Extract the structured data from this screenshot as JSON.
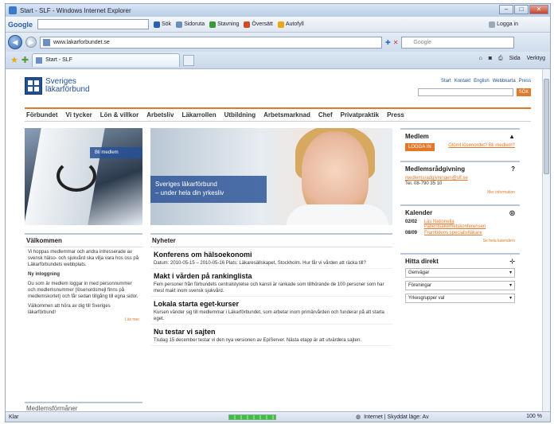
{
  "window": {
    "title": "Start - SLF - Windows Internet Explorer",
    "minimize": "–",
    "maximize": "□",
    "close": "✕"
  },
  "google_toolbar": {
    "logo": "Google",
    "items": [
      "Sök",
      "Sidoruta",
      "Stavning",
      "Översätt",
      "Autofyll"
    ],
    "signin": "Logga in"
  },
  "address": {
    "url": "www.lakarforbundet.se",
    "search_placeholder": "Google"
  },
  "tabs": {
    "active_label": "Start - SLF"
  },
  "command_bar": [
    "Sida",
    "Verktyg"
  ],
  "site": {
    "logo_line1": "Sveriges",
    "logo_line2": "läkarförbund",
    "top_links": [
      "Start",
      "Kontakt",
      "English",
      "Webbkarta",
      "Press"
    ],
    "search_button": "SÖK",
    "nav": [
      "Förbundet",
      "Vi tycker",
      "Lön & villkor",
      "Arbetsliv",
      "Läkarrollen",
      "Utbildning",
      "Arbetsmarknad",
      "Chef",
      "Privatpraktik",
      "Press"
    ],
    "banner_left_label": "Bli medlem",
    "banner_caption_1": "Sveriges läkarförbund",
    "banner_caption_2": "– under hela din yrkesliv",
    "welcome": {
      "title": "Välkommen",
      "p1": "Vi hoppas medlemmar och andra intresserade av svensk hälso- och sjukvård ska vilja vara hos oss på Läkarförbundets webbplats.",
      "p2_title": "Ny inloggning",
      "p2": "Du som är medlem loggar in med personnummer och medlemsnummer (lösenordsmejl finns på medlemskortet) och får sedan tillgång till egna sidor.",
      "p3": "Välkommen att höra av dig till Sveriges läkarförbund!",
      "more": "Läs mer"
    },
    "news": {
      "title": "Nyheter",
      "items": [
        {
          "title": "Konferens om hälsoekonomi",
          "body": "Datum: 2010-05-15 – 2010-05-16 Plats: Läkaresällskapet, Stockholm. Hur får vi vården att räcka till?"
        },
        {
          "title": "Makt i vården på rankinglista",
          "body": "Fem personer från förbundets centralstyrelse och kansli är rankade som tillhörande de 100 personer som har mest makt inom svensk sjukvård."
        },
        {
          "title": "Lokala starta eget-kurser",
          "body": "Kursen vänder sig till medlemmar i Läkarförbundet, som arbetar inom primärvården och funderar på att starta eget."
        },
        {
          "title": "Nu testar vi sajten",
          "body": "Tisdag 15 december testar vi den nya versionen av EpiServer. Nästa etapp är att utvärdera sajten."
        }
      ]
    },
    "medlem": {
      "title": "Medlem",
      "login": "LOGGA IN",
      "forgot": "Glömt lösenordet? Bli medlem?"
    },
    "radgivning": {
      "title": "Medlemsrådgivning",
      "email": "medlemsradgivningen@slf.se",
      "phone": "Tel. 08-790 35 10",
      "more": "Mer information"
    },
    "kalender": {
      "title": "Kalender",
      "events": [
        {
          "date": "02/02",
          "text": "Läs Nationella Patientsäkerhetskonferensen"
        },
        {
          "date": "08/09",
          "text": "Framtidens specialistläkare"
        }
      ],
      "more": "Se hela kalendern"
    },
    "hitta": {
      "title": "Hitta direkt",
      "selects": [
        "Genvägar",
        "Föreningar",
        "Yrkesgrupper val"
      ]
    },
    "footer_box": "Medlemsförmåner"
  },
  "status": {
    "left": "Klar",
    "zone": "Internet | Skyddat läge: Av",
    "zoom": "100 %"
  }
}
